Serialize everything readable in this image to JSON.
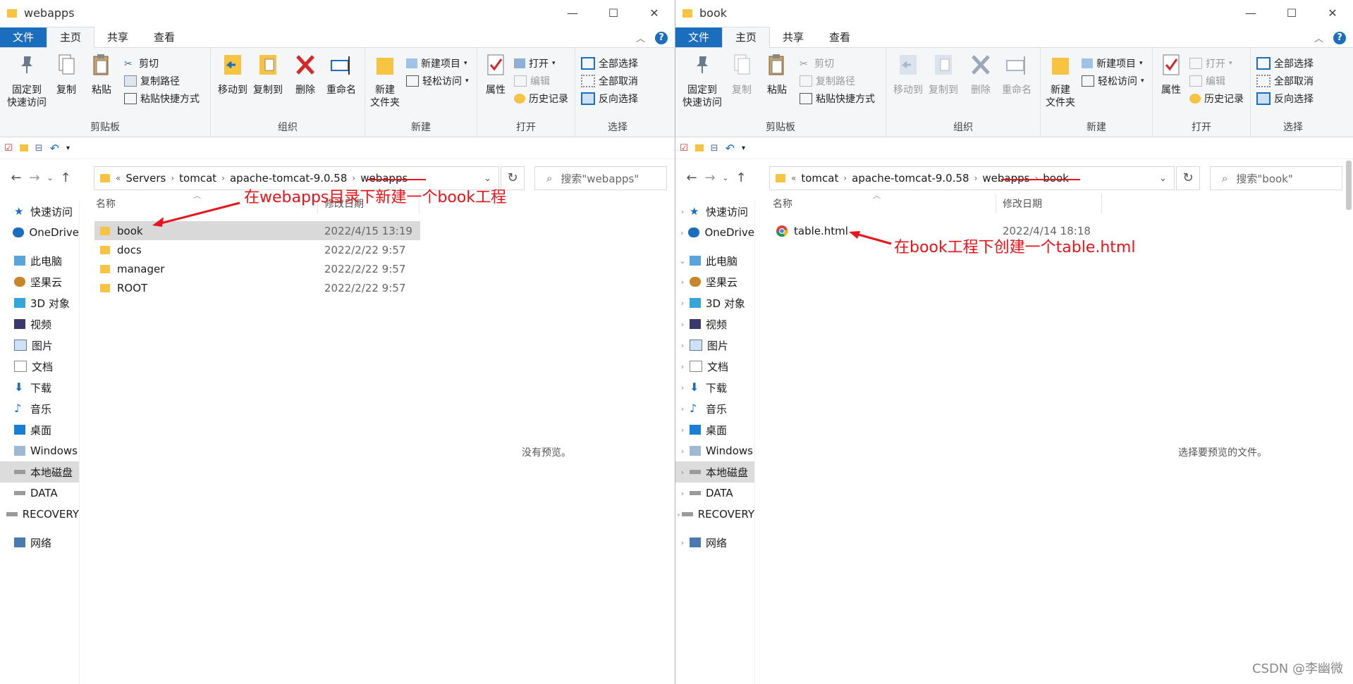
{
  "colors": {
    "accent": "#1a6ebd",
    "annotation": "#e8141b",
    "folder": "#f6c343"
  },
  "ribbon": {
    "tabs": [
      "文件",
      "主页",
      "共享",
      "查看"
    ],
    "help": "?",
    "clipboard": {
      "pin": "固定到",
      "pin2": "快速访问",
      "copy": "复制",
      "paste": "粘贴",
      "cut": "剪切",
      "copy_path": "复制路径",
      "paste_shortcut": "粘贴快捷方式",
      "group": "剪贴板"
    },
    "organize": {
      "move_to": "移动到",
      "copy_to": "复制到",
      "delete": "删除",
      "rename": "重命名",
      "group": "组织"
    },
    "new": {
      "new_folder": "新建",
      "new_folder2": "文件夹",
      "new_item": "新建项目",
      "easy_access": "轻松访问",
      "group": "新建"
    },
    "open": {
      "properties": "属性",
      "open": "打开",
      "edit": "编辑",
      "history": "历史记录",
      "group": "打开"
    },
    "select": {
      "select_all": "全部选择",
      "select_none": "全部取消",
      "invert": "反向选择",
      "group": "选择"
    }
  },
  "sidebar": {
    "items": [
      "快速访问",
      "OneDrive",
      "此电脑",
      "坚果云",
      "3D 对象",
      "视频",
      "图片",
      "文档",
      "下载",
      "音乐",
      "桌面",
      "Windows",
      "本地磁盘",
      "DATA",
      "RECOVERY",
      "网络"
    ]
  },
  "columns": {
    "name": "名称",
    "date": "修改日期"
  },
  "left": {
    "title": "webapps",
    "breadcrumb": {
      "prefix": "«",
      "items": [
        "Servers",
        "tomcat",
        "apache-tomcat-9.0.58",
        "webapps"
      ]
    },
    "search_placeholder": "搜索\"webapps\"",
    "files": [
      {
        "name": "book",
        "date": "2022/4/15 13:19"
      },
      {
        "name": "docs",
        "date": "2022/2/22 9:57"
      },
      {
        "name": "manager",
        "date": "2022/2/22 9:57"
      },
      {
        "name": "ROOT",
        "date": "2022/2/22 9:57"
      }
    ],
    "preview": "没有预览。",
    "annotation": "在webapps目录下新建一个book工程"
  },
  "right": {
    "title": "book",
    "breadcrumb": {
      "prefix": "«",
      "items": [
        "tomcat",
        "apache-tomcat-9.0.58",
        "webapps",
        "book"
      ]
    },
    "search_placeholder": "搜索\"book\"",
    "files": [
      {
        "name": "table.html",
        "date": "2022/4/14 18:18"
      }
    ],
    "preview": "选择要预览的文件。",
    "annotation": "在book工程下创建一个table.html"
  },
  "watermark": "CSDN @李幽微"
}
